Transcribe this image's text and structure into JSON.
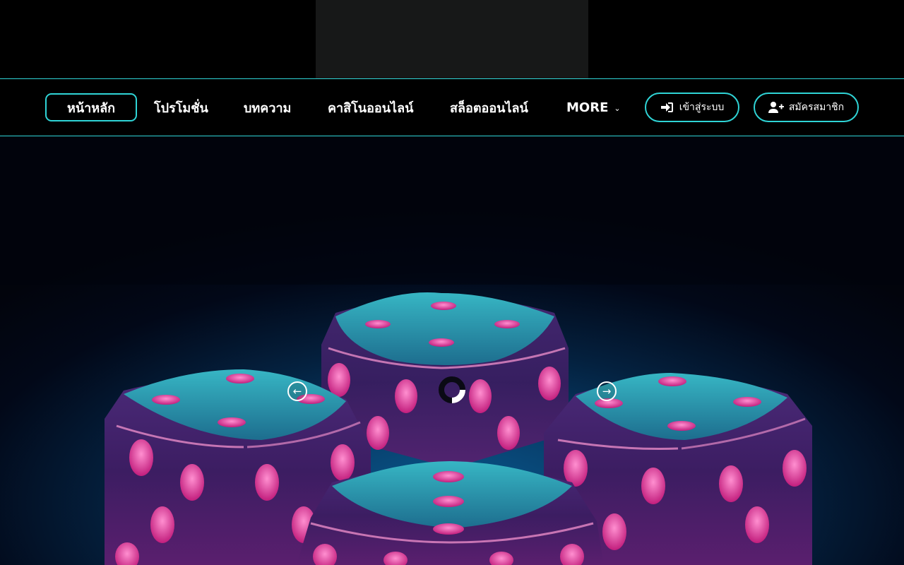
{
  "header": {
    "logo_area": "logo-placeholder"
  },
  "nav": {
    "home": "หน้าหลัก",
    "promotions": "โปรโมชั่น",
    "articles": "บทความ",
    "casino": "คาสิโนออนไลน์",
    "slots": "สล็อตออนไลน์",
    "more": "MORE",
    "more_icon": "chevron-down-icon"
  },
  "auth": {
    "login_label": "เข้าสู่ระบบ",
    "login_icon": "sign-in-icon",
    "register_label": "สมัครสมาชิก",
    "register_icon": "user-plus-icon"
  },
  "colors": {
    "accent": "#2fd4d6",
    "background": "#000000",
    "logo_box": "#171818",
    "dice_pink": "#c02a8a",
    "hero_blue": "#0a5a8f"
  },
  "slider": {
    "prev_icon": "arrow-left-circle-icon",
    "next_icon": "arrow-right-circle-icon",
    "loader_icon": "loading-spinner-icon",
    "image": "dice-hero-image"
  }
}
